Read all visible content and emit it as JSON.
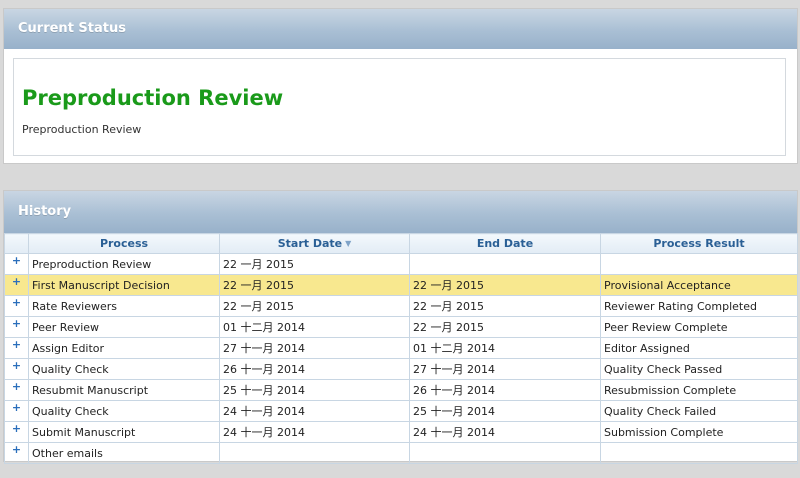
{
  "status": {
    "header": "Current Status",
    "title": "Preproduction Review",
    "subtitle": "Preproduction Review"
  },
  "history": {
    "header": "History",
    "columns": {
      "process": "Process",
      "start_date": "Start Date",
      "end_date": "End Date",
      "result": "Process Result"
    },
    "sort_icon": "sort-down-icon",
    "expand_symbol": "+",
    "selected_row": 1,
    "rows": [
      {
        "process": "Preproduction Review",
        "start": "22 一月 2015",
        "end": "",
        "result": ""
      },
      {
        "process": "First Manuscript Decision",
        "start": "22 一月 2015",
        "end": "22 一月 2015",
        "result": "Provisional Acceptance"
      },
      {
        "process": "Rate Reviewers",
        "start": "22 一月 2015",
        "end": "22 一月 2015",
        "result": "Reviewer Rating Completed"
      },
      {
        "process": "Peer Review",
        "start": "01 十二月 2014",
        "end": "22 一月 2015",
        "result": "Peer Review Complete"
      },
      {
        "process": "Assign Editor",
        "start": "27 十一月 2014",
        "end": "01 十二月 2014",
        "result": "Editor Assigned"
      },
      {
        "process": "Quality Check",
        "start": "26 十一月 2014",
        "end": "27 十一月 2014",
        "result": "Quality Check Passed"
      },
      {
        "process": "Resubmit Manuscript",
        "start": "25 十一月 2014",
        "end": "26 十一月 2014",
        "result": "Resubmission Complete"
      },
      {
        "process": "Quality Check",
        "start": "24 十一月 2014",
        "end": "25 十一月 2014",
        "result": "Quality Check Failed"
      },
      {
        "process": "Submit Manuscript",
        "start": "24 十一月 2014",
        "end": "24 十一月 2014",
        "result": "Submission Complete"
      },
      {
        "process": "Other emails",
        "start": "",
        "end": "",
        "result": ""
      }
    ]
  },
  "colors": {
    "status_title": "#1a9a1a",
    "header_text": "#2a5f95",
    "selected_row": "#f8e88f"
  }
}
